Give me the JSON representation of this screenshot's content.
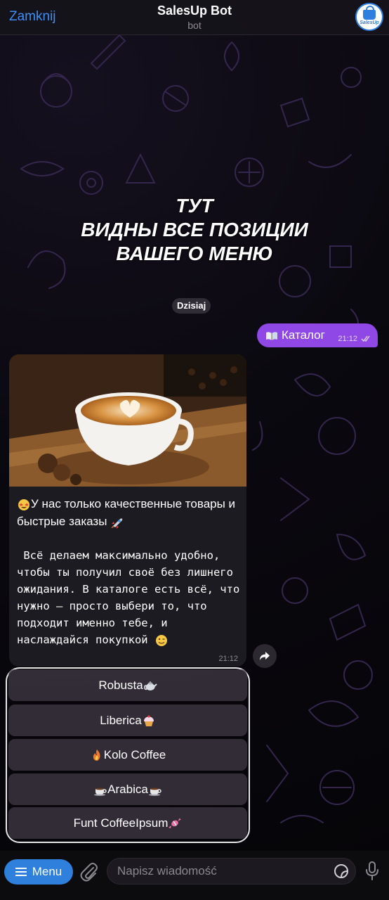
{
  "header": {
    "close_label": "Zamknij",
    "title": "SalesUp Bot",
    "subtitle": "bot",
    "avatar_text": "SalesUp"
  },
  "promo_caption": {
    "line1": "ТУТ",
    "line2": "ВИДНЫ ВСЕ ПОЗИЦИИ",
    "line3": "ВАШЕГО МЕНЮ"
  },
  "date_chip": "Dzisiaj",
  "outgoing": {
    "icon": "open-book-icon",
    "text": "Каталог",
    "time": "21:12",
    "status": "read-double-check"
  },
  "incoming": {
    "image": "latte-art-coffee-cup-photo",
    "paragraph1": "У нас только качественные товары и быстрые заказы",
    "paragraph1_lead_emoji": "star-struck-emoji",
    "paragraph1_trail_emoji": "rocket-emoji",
    "paragraph2": " Всё делаем максимально удобно, чтобы ты получил своё без лишнего ожидания. В каталоге есть всё, что нужно — просто выбери то, что подходит именно тебе, и наслаждайся покупкой",
    "paragraph2_trail_emoji": "winking-face-emoji",
    "time": "21:12"
  },
  "keyboard": [
    {
      "label": "Robusta",
      "emoji_after": "teapot-emoji"
    },
    {
      "label": "Liberica",
      "emoji_after": "cupcake-emoji"
    },
    {
      "label": "Kolo Coffee",
      "emoji_before": "fire-emoji"
    },
    {
      "label": "Arabica",
      "emoji_before": "hot-beverage-emoji",
      "emoji_after": "hot-beverage-emoji"
    },
    {
      "label": "Funt CoffeeIpsum",
      "emoji_after": "candy-emoji"
    }
  ],
  "input_bar": {
    "menu_label": "Menu",
    "placeholder": "Napisz wiadomość"
  },
  "colors": {
    "accent_blue": "#3e8ef7",
    "outgoing_bubble": "#8f47e6",
    "menu_button": "#2f7fdc",
    "wallpaper_doodle": "#3a2a55"
  }
}
